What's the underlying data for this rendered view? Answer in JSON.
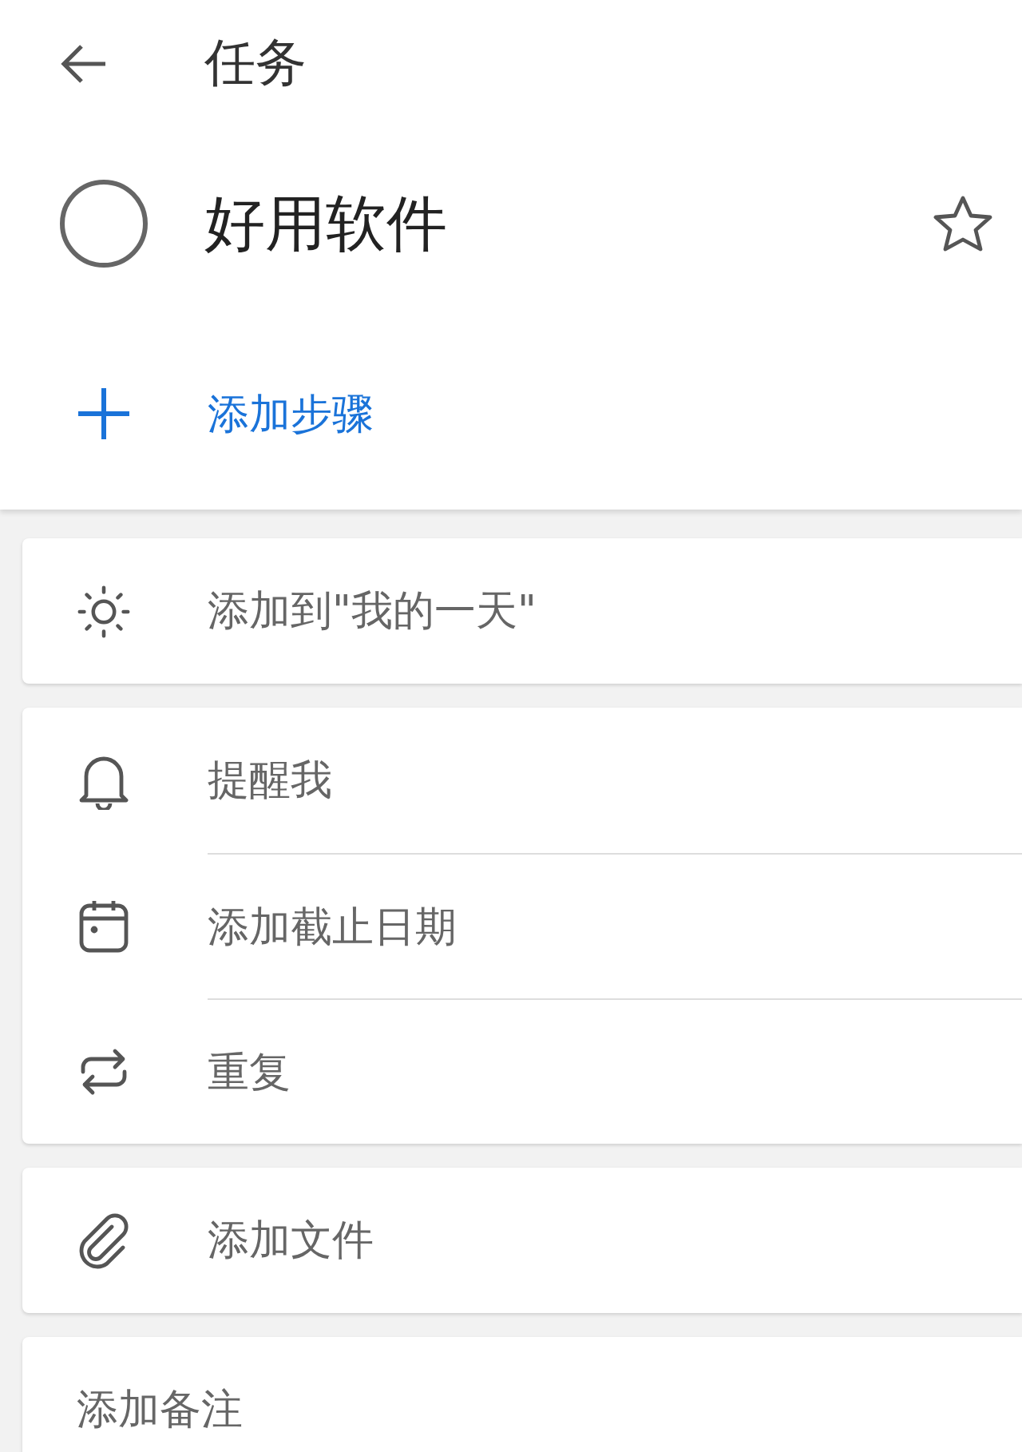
{
  "header": {
    "title": "任务"
  },
  "task": {
    "title": "好用软件",
    "completed": false,
    "starred": false
  },
  "add_step": {
    "label": "添加步骤"
  },
  "cards": [
    {
      "rows": [
        {
          "kind": "sun",
          "label": "添加到\"我的一天\""
        }
      ]
    },
    {
      "rows": [
        {
          "kind": "bell",
          "label": "提醒我"
        },
        {
          "kind": "calendar",
          "label": "添加截止日期"
        },
        {
          "kind": "repeat",
          "label": "重复"
        }
      ]
    },
    {
      "rows": [
        {
          "kind": "clip",
          "label": "添加文件"
        }
      ]
    },
    {
      "rows": [
        {
          "kind": "note",
          "label": "添加备注"
        }
      ]
    }
  ]
}
